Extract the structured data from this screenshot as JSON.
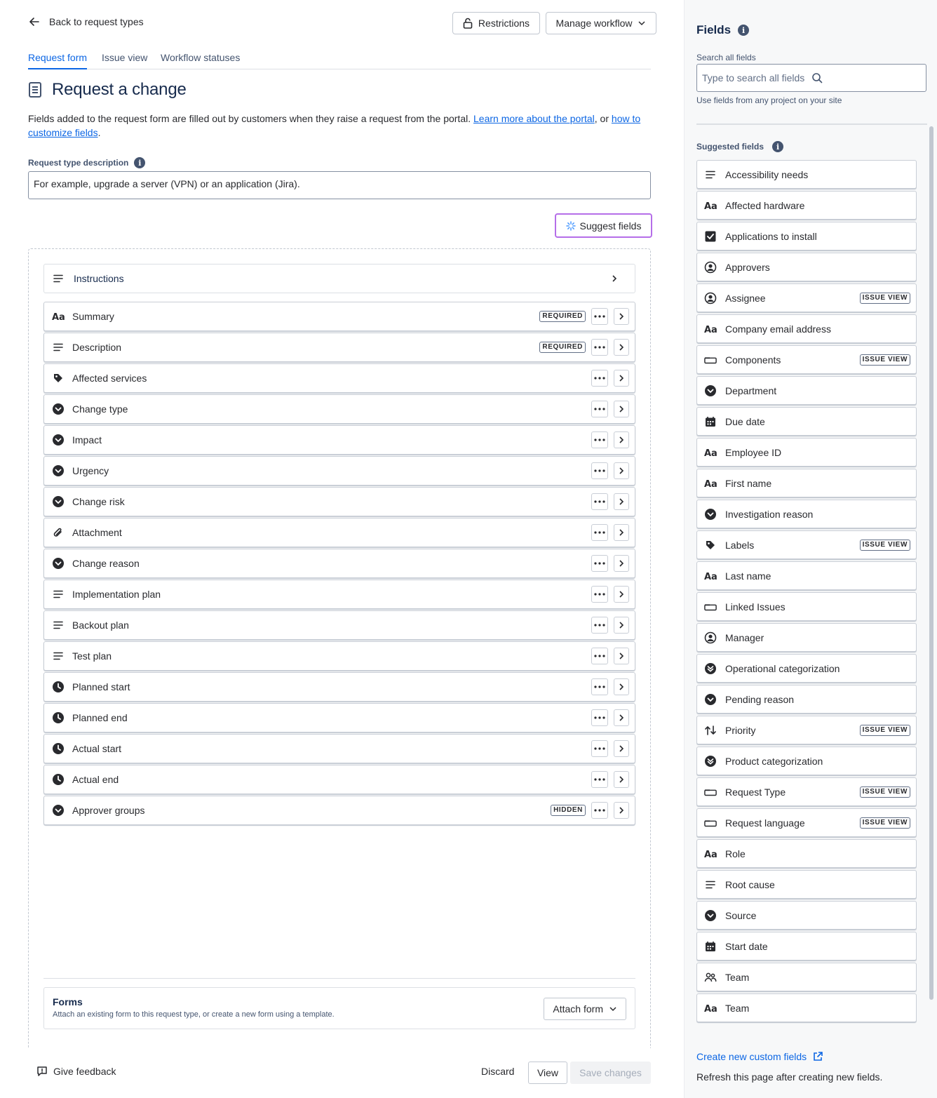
{
  "nav": {
    "back_label": "Back to request types"
  },
  "header": {
    "restrictions_label": "Restrictions",
    "manage_workflow_label": "Manage workflow"
  },
  "tabs": [
    {
      "label": "Request form",
      "active": true
    },
    {
      "label": "Issue view",
      "active": false
    },
    {
      "label": "Workflow statuses",
      "active": false
    }
  ],
  "page": {
    "title": "Request a change",
    "intro_text": "Fields added to the request form are filled out by customers when they raise a request from the portal. ",
    "intro_link1": "Learn more about the portal",
    "intro_mid": ", or ",
    "intro_link2": "how to customize fields",
    "intro_end": ".",
    "description_label": "Request type description",
    "description_value": "For example, upgrade a server (VPN) or an application (Jira).",
    "suggest_label": "Suggest fields"
  },
  "form": {
    "instructions_label": "Instructions",
    "fields": [
      {
        "name": "Summary",
        "icon": "text",
        "badge": "REQUIRED"
      },
      {
        "name": "Description",
        "icon": "paragraph",
        "badge": "REQUIRED"
      },
      {
        "name": "Affected services",
        "icon": "tag",
        "badge": ""
      },
      {
        "name": "Change type",
        "icon": "select",
        "badge": ""
      },
      {
        "name": "Impact",
        "icon": "select",
        "badge": ""
      },
      {
        "name": "Urgency",
        "icon": "select",
        "badge": ""
      },
      {
        "name": "Change risk",
        "icon": "select",
        "badge": ""
      },
      {
        "name": "Attachment",
        "icon": "attachment",
        "badge": ""
      },
      {
        "name": "Change reason",
        "icon": "select",
        "badge": ""
      },
      {
        "name": "Implementation plan",
        "icon": "paragraph",
        "badge": ""
      },
      {
        "name": "Backout plan",
        "icon": "paragraph",
        "badge": ""
      },
      {
        "name": "Test plan",
        "icon": "paragraph",
        "badge": ""
      },
      {
        "name": "Planned start",
        "icon": "clock",
        "badge": ""
      },
      {
        "name": "Planned end",
        "icon": "clock",
        "badge": ""
      },
      {
        "name": "Actual start",
        "icon": "clock",
        "badge": ""
      },
      {
        "name": "Actual end",
        "icon": "clock",
        "badge": ""
      },
      {
        "name": "Approver groups",
        "icon": "select",
        "badge": "HIDDEN"
      }
    ],
    "forms_title": "Forms",
    "forms_desc": "Attach an existing form to this request type, or create a new form using a template.",
    "attach_label": "Attach form"
  },
  "footer": {
    "feedback_label": "Give feedback",
    "discard_label": "Discard",
    "view_label": "View",
    "save_label": "Save changes"
  },
  "sidebar": {
    "title": "Fields",
    "search_label": "Search all fields",
    "search_placeholder": "Type to search all fields",
    "search_help": "Use fields from any project on your site",
    "suggested_label": "Suggested fields",
    "fields": [
      {
        "name": "Accessibility needs",
        "icon": "paragraph",
        "badge": ""
      },
      {
        "name": "Affected hardware",
        "icon": "text",
        "badge": ""
      },
      {
        "name": "Applications to install",
        "icon": "checkbox",
        "badge": ""
      },
      {
        "name": "Approvers",
        "icon": "person",
        "badge": ""
      },
      {
        "name": "Assignee",
        "icon": "person",
        "badge": "ISSUE VIEW"
      },
      {
        "name": "Company email address",
        "icon": "text",
        "badge": ""
      },
      {
        "name": "Components",
        "icon": "component",
        "badge": "ISSUE VIEW"
      },
      {
        "name": "Department",
        "icon": "select",
        "badge": ""
      },
      {
        "name": "Due date",
        "icon": "calendar",
        "badge": ""
      },
      {
        "name": "Employee ID",
        "icon": "text",
        "badge": ""
      },
      {
        "name": "First name",
        "icon": "text",
        "badge": ""
      },
      {
        "name": "Investigation reason",
        "icon": "select",
        "badge": ""
      },
      {
        "name": "Labels",
        "icon": "tag",
        "badge": "ISSUE VIEW"
      },
      {
        "name": "Last name",
        "icon": "text",
        "badge": ""
      },
      {
        "name": "Linked Issues",
        "icon": "component",
        "badge": ""
      },
      {
        "name": "Manager",
        "icon": "person",
        "badge": ""
      },
      {
        "name": "Operational categorization",
        "icon": "cascade",
        "badge": ""
      },
      {
        "name": "Pending reason",
        "icon": "select",
        "badge": ""
      },
      {
        "name": "Priority",
        "icon": "priority",
        "badge": "ISSUE VIEW"
      },
      {
        "name": "Product categorization",
        "icon": "cascade",
        "badge": ""
      },
      {
        "name": "Request Type",
        "icon": "component",
        "badge": "ISSUE VIEW"
      },
      {
        "name": "Request language",
        "icon": "component",
        "badge": "ISSUE VIEW"
      },
      {
        "name": "Role",
        "icon": "text",
        "badge": ""
      },
      {
        "name": "Root cause",
        "icon": "paragraph",
        "badge": ""
      },
      {
        "name": "Source",
        "icon": "select",
        "badge": ""
      },
      {
        "name": "Start date",
        "icon": "calendar",
        "badge": ""
      },
      {
        "name": "Team",
        "icon": "team",
        "badge": ""
      },
      {
        "name": "Team",
        "icon": "text",
        "badge": ""
      }
    ],
    "create_label": "Create new custom fields",
    "refresh_text": "Refresh this page after creating new fields."
  }
}
